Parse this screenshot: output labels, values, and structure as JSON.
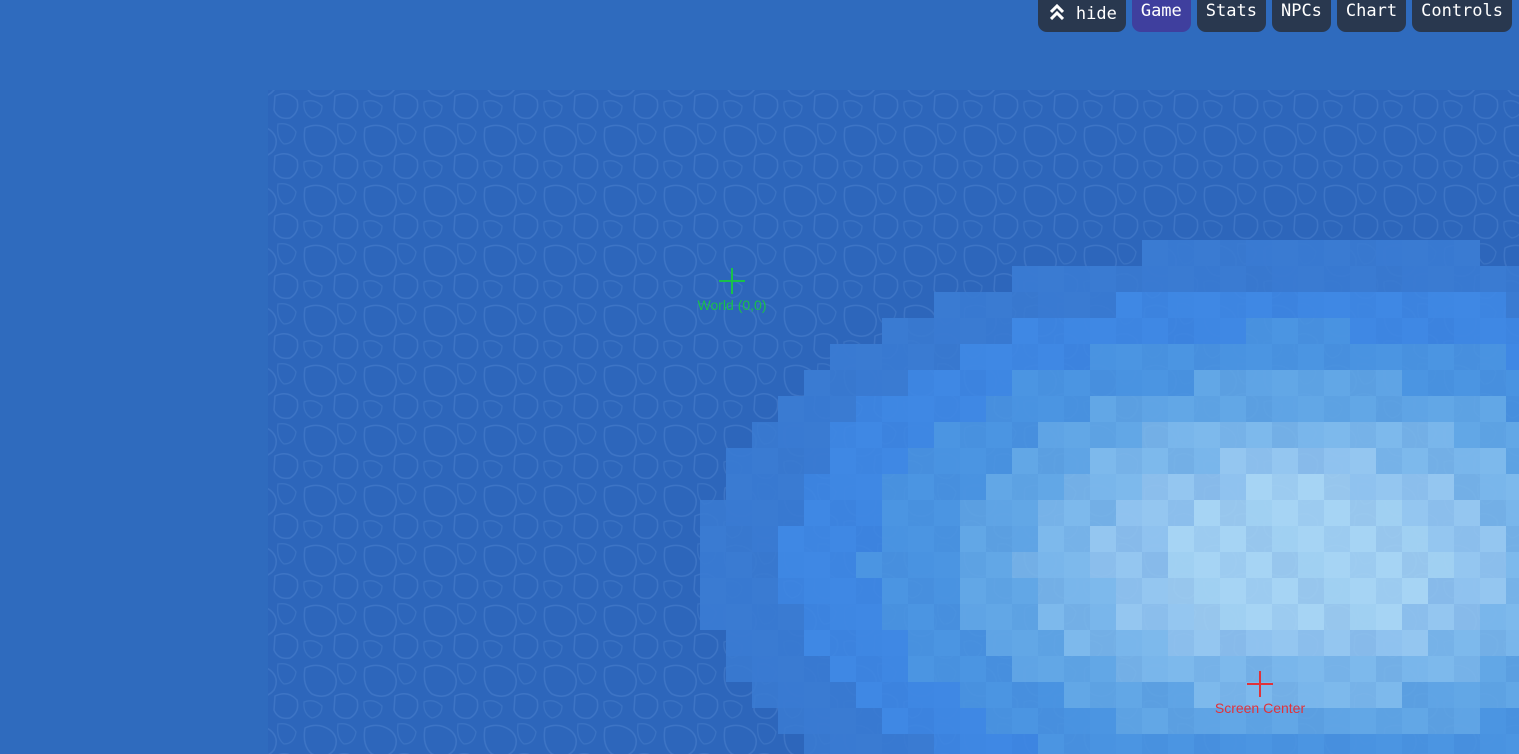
{
  "nav": {
    "hide_label": "hide",
    "hide_icon": "double-chevron-up-icon",
    "tabs": [
      {
        "label": "Game",
        "active": true
      },
      {
        "label": "Stats",
        "active": false
      },
      {
        "label": "NPCs",
        "active": false
      },
      {
        "label": "Chart",
        "active": false
      },
      {
        "label": "Controls",
        "active": false
      }
    ]
  },
  "markers": {
    "world_origin": {
      "label": "World (0,0)",
      "color": "#19c04a"
    },
    "screen_center": {
      "label": "Screen Center",
      "color": "#e0323a"
    }
  },
  "colors": {
    "deep_water": "#2f6bbe",
    "shallow_water": "#4189e0",
    "land": "#9fd0f0",
    "nav_bg": "#29384f",
    "nav_active": "#3f3f9e"
  }
}
